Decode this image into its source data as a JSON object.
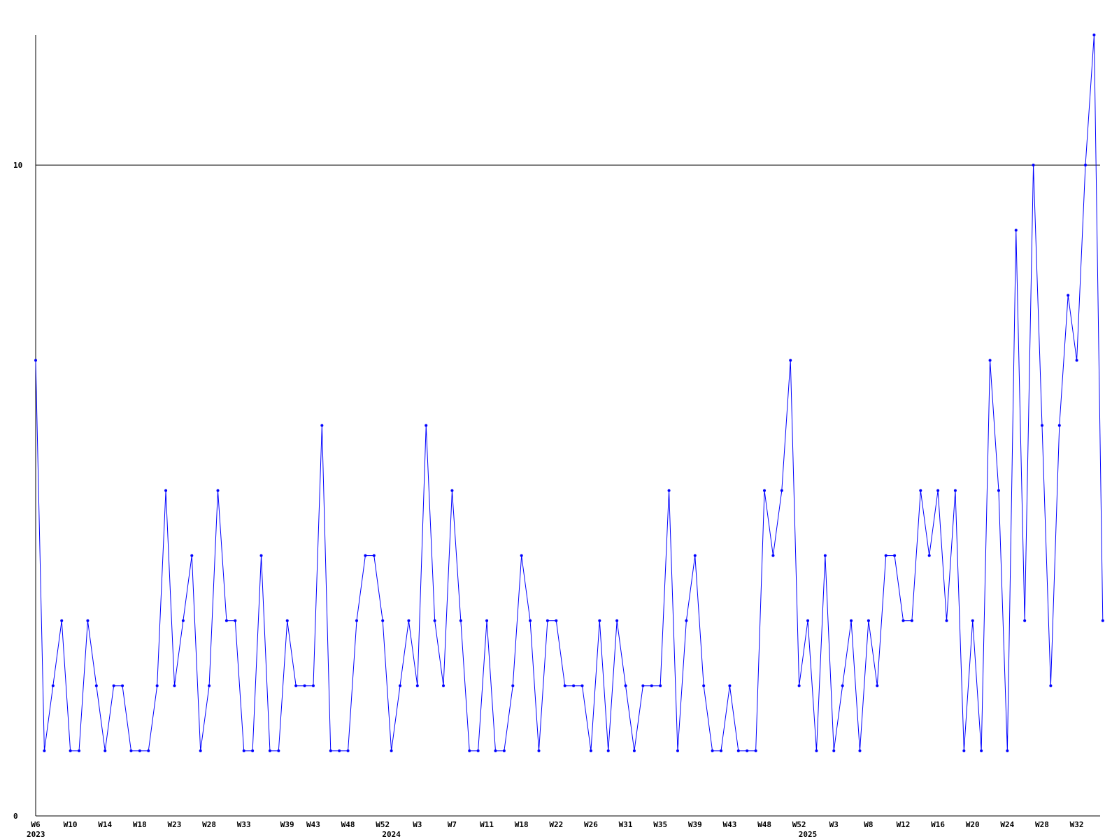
{
  "chart_data": {
    "type": "line",
    "title": "",
    "xlabel": "",
    "ylabel": "",
    "ylim": [
      0,
      12
    ],
    "grid": false,
    "legend": "none",
    "reference_line": 10,
    "y_ticks": [
      0,
      10
    ],
    "x_tick_labels": [
      "W6",
      "W10",
      "W14",
      "W18",
      "W23",
      "W28",
      "W33",
      "W39",
      "W43",
      "W48",
      "W52",
      "W3",
      "W7",
      "W11",
      "W18",
      "W22",
      "W26",
      "W31",
      "W35",
      "W39",
      "W43",
      "W48",
      "W52",
      "W3",
      "W8",
      "W12",
      "W16",
      "W20",
      "W24",
      "W28",
      "W32"
    ],
    "x_tick_positions": [
      0,
      4,
      8,
      12,
      16,
      20,
      24,
      29,
      32,
      36,
      40,
      44,
      48,
      52,
      56,
      60,
      64,
      68,
      72,
      76,
      80,
      84,
      88,
      92,
      96,
      100,
      104,
      108,
      112,
      116,
      120
    ],
    "year_labels": [
      {
        "label": "2023",
        "index": 0
      },
      {
        "label": "2024",
        "index": 41
      },
      {
        "label": "2025",
        "index": 89
      }
    ],
    "series": [
      {
        "values": [
          7,
          1,
          2,
          3,
          1,
          1,
          3,
          2,
          1,
          2,
          2,
          1,
          1,
          1,
          2,
          5,
          2,
          3,
          4,
          1,
          2,
          5,
          3,
          3,
          1,
          1,
          4,
          1,
          1,
          3,
          2,
          2,
          2,
          6,
          1,
          1,
          1,
          3,
          4,
          4,
          3,
          1,
          2,
          3,
          2,
          6,
          3,
          2,
          5,
          3,
          1,
          1,
          3,
          1,
          1,
          2,
          4,
          3,
          1,
          3,
          3,
          2,
          2,
          2,
          1,
          3,
          1,
          3,
          2,
          1,
          2,
          2,
          2,
          5,
          1,
          3,
          4,
          2,
          1,
          1,
          2,
          1,
          1,
          1,
          5,
          4,
          5,
          7,
          2,
          3,
          1,
          4,
          1,
          2,
          3,
          1,
          3,
          2,
          4,
          4,
          3,
          3,
          5,
          4,
          5,
          3,
          5,
          1,
          3,
          1,
          7,
          5,
          1,
          9,
          3,
          10,
          6,
          2,
          6,
          8,
          7,
          10,
          12,
          3
        ]
      }
    ]
  },
  "colors": {
    "line": "#0000ff",
    "axis": "#000000",
    "background": "#ffffff"
  }
}
